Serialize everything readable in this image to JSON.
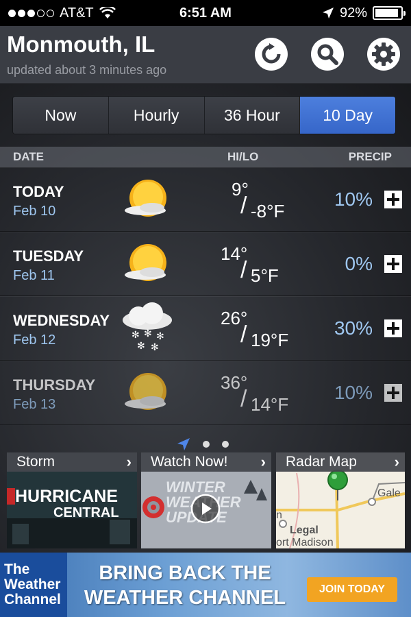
{
  "status_bar": {
    "carrier": "AT&T",
    "time": "6:51 AM",
    "battery": "92%",
    "battery_level": 0.92
  },
  "header": {
    "city": "Monmouth, IL",
    "updated": "updated about 3 minutes ago",
    "buttons": [
      "refresh-icon",
      "search-icon",
      "gear-icon"
    ]
  },
  "tabs": [
    {
      "label": "Now",
      "active": false
    },
    {
      "label": "Hourly",
      "active": false
    },
    {
      "label": "36 Hour",
      "active": false
    },
    {
      "label": "10 Day",
      "active": true
    }
  ],
  "columns": {
    "date": "DATE",
    "hilo": "HI/LO",
    "precip": "PRECIP"
  },
  "forecast": [
    {
      "day": "TODAY",
      "date": "Feb 10",
      "icon": "partly-sunny-icon",
      "hi": "9°",
      "lo": "-8°F",
      "precip": "10%"
    },
    {
      "day": "TUESDAY",
      "date": "Feb 11",
      "icon": "partly-sunny-icon",
      "hi": "14°",
      "lo": "5°F",
      "precip": "0%"
    },
    {
      "day": "WEDNESDAY",
      "date": "Feb 12",
      "icon": "snow-cloud-icon",
      "hi": "26°",
      "lo": "19°F",
      "precip": "30%"
    },
    {
      "day": "THURSDAY",
      "date": "Feb 13",
      "icon": "partly-sunny-icon",
      "hi": "36°",
      "lo": "14°F",
      "precip": "10%"
    }
  ],
  "tiles": [
    {
      "label": "Storm",
      "line1": "HURRICANE",
      "line2": "CENTRAL"
    },
    {
      "label": "Watch Now!",
      "line1": "WINTER",
      "line2": "WEATHER",
      "line3": "UPDATE"
    },
    {
      "label": "Radar Map",
      "map_labels": [
        "Gale",
        "Legal",
        "ort Madison",
        "n"
      ]
    }
  ],
  "banner": {
    "logo": [
      "The",
      "Weather",
      "Channel"
    ],
    "line1": "BRING BACK THE",
    "line2": "WEATHER CHANNEL",
    "button": "JOIN TODAY"
  },
  "colors": {
    "accent": "#3d6fd2",
    "precip_text": "#9fc7f0",
    "header_bg": "#3a3d44",
    "join_button": "#f2a422"
  }
}
